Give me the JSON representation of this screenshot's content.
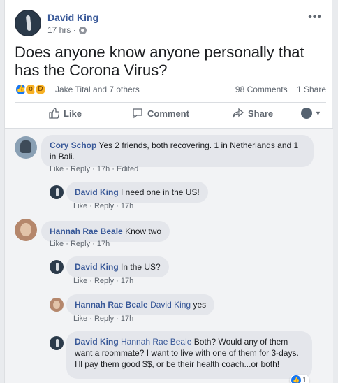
{
  "post": {
    "author": "David King",
    "time": "17 hrs ·",
    "more": "•••",
    "text": "Does anyone know anyone personally that has the Corona Virus?",
    "reaction_names": "Jake Tital and 7 others",
    "comments_count": "98 Comments",
    "shares_count": "1 Share"
  },
  "actions": {
    "like": "Like",
    "comment": "Comment",
    "share": "Share"
  },
  "icons": {
    "like_reaction": "like-icon",
    "wow_reaction": "wow-icon",
    "haha_reaction": "haha-icon"
  },
  "comments": [
    {
      "name": "Cory Schop",
      "text": "Yes 2 friends, both recovering. 1 in Netherlands and 1 in Bali.",
      "like": "Like",
      "reply": "Reply",
      "time": "17h",
      "edited": "Edited"
    },
    {
      "name": "David King",
      "text": "I need one in the US!",
      "like": "Like",
      "reply": "Reply",
      "time": "17h"
    },
    {
      "name": "Hannah Rae Beale",
      "text": "Know two",
      "like": "Like",
      "reply": "Reply",
      "time": "17h"
    },
    {
      "name": "David King",
      "text": "In the US?",
      "like": "Like",
      "reply": "Reply",
      "time": "17h"
    },
    {
      "name": "Hannah Rae Beale",
      "tag": "David King",
      "text": "yes",
      "like": "Like",
      "reply": "Reply",
      "time": "17h"
    },
    {
      "name": "David King",
      "tag": "Hannah Rae Beale",
      "text": "Both? Would any of them want a roommate? I want to live with one of them for 3-days. I'll pay them good $$, or be their health coach...or both!",
      "like_count": "1"
    }
  ]
}
